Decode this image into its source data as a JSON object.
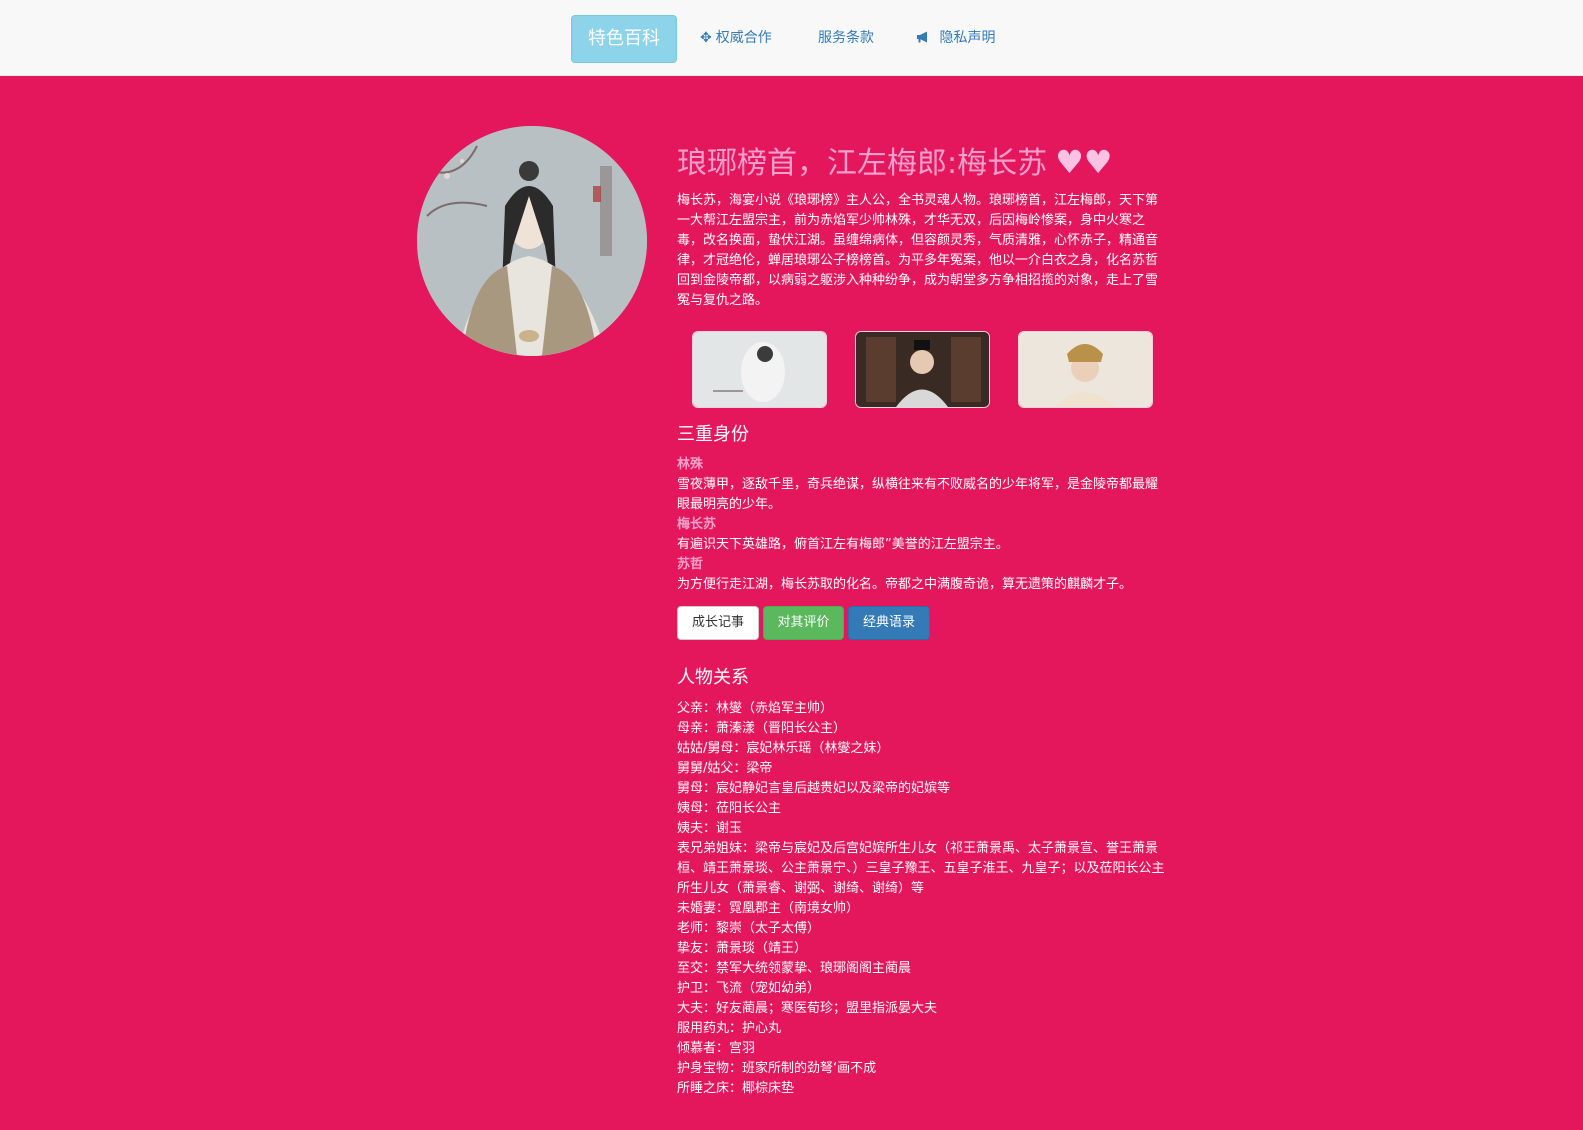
{
  "nav": {
    "items": [
      {
        "label": "特色百科",
        "icon": ""
      },
      {
        "label": "权威合作",
        "icon": "move-icon"
      },
      {
        "label": "服务条款",
        "icon": ""
      },
      {
        "label": "隐私声明",
        "icon": "bullhorn-icon"
      }
    ]
  },
  "colors": {
    "background": "#e4175c",
    "title": "#f59fcd",
    "nav_active": "#8dd3ea",
    "link": "#337ab7"
  },
  "hero": {
    "title": "琅琊榜首，江左梅郎:梅长苏",
    "hearts": "♥♥",
    "intro": "梅长苏，海宴小说《琅琊榜》主人公，全书灵魂人物。琅琊榜首，江左梅郎，天下第一大帮江左盟宗主，前为赤焰军少帅林殊，才华无双，后因梅岭惨案，身中火寒之毒，改名换面，蛰伏江湖。虽缠绵病体，但容颜灵秀，气质清雅，心怀赤子，精通音律，才冠绝伦，蝉居琅琊公子榜榜首。为平多年冤案，他以一介白衣之身，化名苏哲回到金陵帝都，以病弱之躯涉入种种纷争，成为朝堂多方争相招揽的对象，走上了雪冤与复仇之路。"
  },
  "identities": {
    "heading": "三重身份",
    "items": [
      {
        "name": "林殊",
        "desc": "雪夜薄甲，逐敌千里，奇兵绝谋，纵横往来有不败威名的少年将军，是金陵帝都最耀眼最明亮的少年。"
      },
      {
        "name": "梅长苏",
        "desc": "有遍识天下英雄路，俯首江左有梅郎”美誉的江左盟宗主。"
      },
      {
        "name": "苏哲",
        "desc": "为方便行走江湖，梅长苏取的化名。帝都之中满腹奇诡，算无遗策的麒麟才子。"
      }
    ]
  },
  "buttons": {
    "growth": "成长记事",
    "review": "对其评价",
    "quotes": "经典语录"
  },
  "relations": {
    "heading": "人物关系",
    "items": [
      "父亲：林燮（赤焰军主帅）",
      "母亲：萧溱漾（晋阳长公主）",
      "姑姑/舅母：宸妃林乐瑶（林燮之妹）",
      "舅舅/姑父：梁帝",
      "舅母：宸妃静妃言皇后越贵妃以及梁帝的妃嫔等",
      "姨母：莅阳长公主",
      "姨夫：谢玉",
      "表兄弟姐妹：梁帝与宸妃及后宫妃嫔所生儿女（祁王萧景禹、太子萧景宣、誉王萧景桓、靖王萧景琰、公主萧景宁、）三皇子豫王、五皇子淮王、九皇子；以及莅阳长公主所生儿女（萧景睿、谢弼、谢绮、谢绮）等",
      "未婚妻：霓凰郡主（南境女帅）",
      "老师：黎崇（太子太傅）",
      "挚友：萧景琰（靖王）",
      "至交：禁军大统领蒙挚、琅琊阁阁主蔺晨",
      "护卫：飞流（宠如幼弟）",
      "大夫：好友蔺晨；寒医荀珍；盟里指派晏大夫",
      "服用药丸：护心丸",
      "倾慕者：宫羽",
      "护身宝物：班家所制的劲弩‘画不成",
      "所睡之床：椰棕床垫"
    ]
  }
}
